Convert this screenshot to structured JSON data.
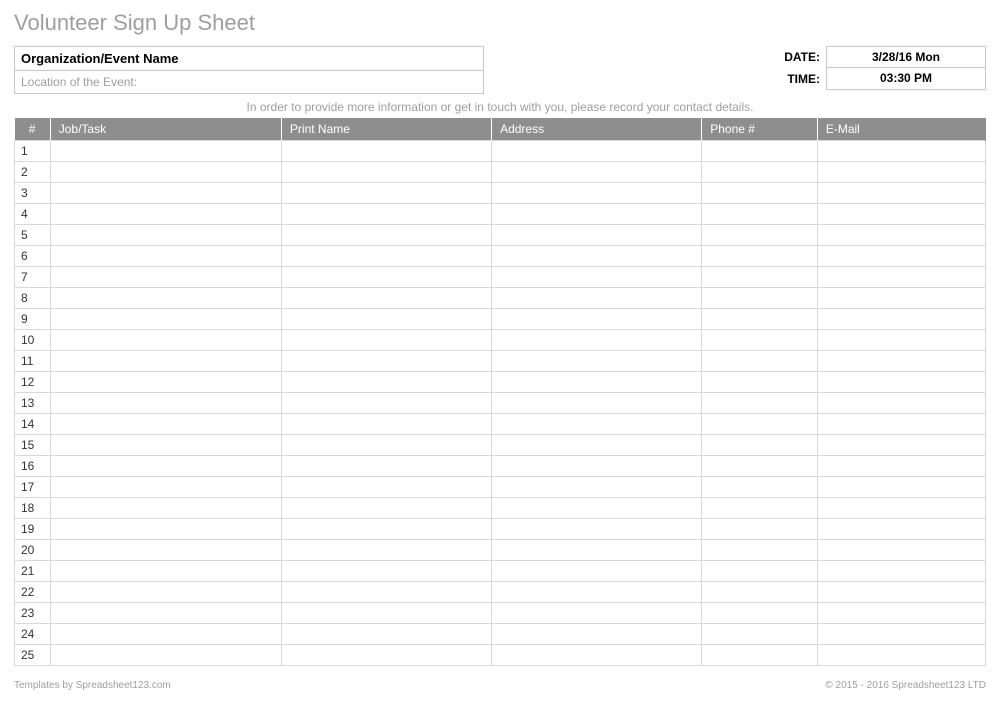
{
  "title": "Volunteer Sign Up Sheet",
  "org_label": "Organization/Event Name",
  "location_label": "Location of the Event:",
  "date_label": "DATE:",
  "date_value": "3/28/16 Mon",
  "time_label": "TIME:",
  "time_value": "03:30 PM",
  "instructions": "In order to provide more information or get in touch with you, please record your contact details.",
  "columns": {
    "num": "#",
    "job": "Job/Task",
    "name": "Print Name",
    "address": "Address",
    "phone": "Phone #",
    "email": "E-Mail"
  },
  "rows": [
    {
      "num": "1"
    },
    {
      "num": "2"
    },
    {
      "num": "3"
    },
    {
      "num": "4"
    },
    {
      "num": "5"
    },
    {
      "num": "6"
    },
    {
      "num": "7"
    },
    {
      "num": "8"
    },
    {
      "num": "9"
    },
    {
      "num": "10"
    },
    {
      "num": "11"
    },
    {
      "num": "12"
    },
    {
      "num": "13"
    },
    {
      "num": "14"
    },
    {
      "num": "15"
    },
    {
      "num": "16"
    },
    {
      "num": "17"
    },
    {
      "num": "18"
    },
    {
      "num": "19"
    },
    {
      "num": "20"
    },
    {
      "num": "21"
    },
    {
      "num": "22"
    },
    {
      "num": "23"
    },
    {
      "num": "24"
    },
    {
      "num": "25"
    }
  ],
  "footer_left": "Templates by Spreadsheet123.com",
  "footer_right": "© 2015 - 2016 Spreadsheet123 LTD"
}
